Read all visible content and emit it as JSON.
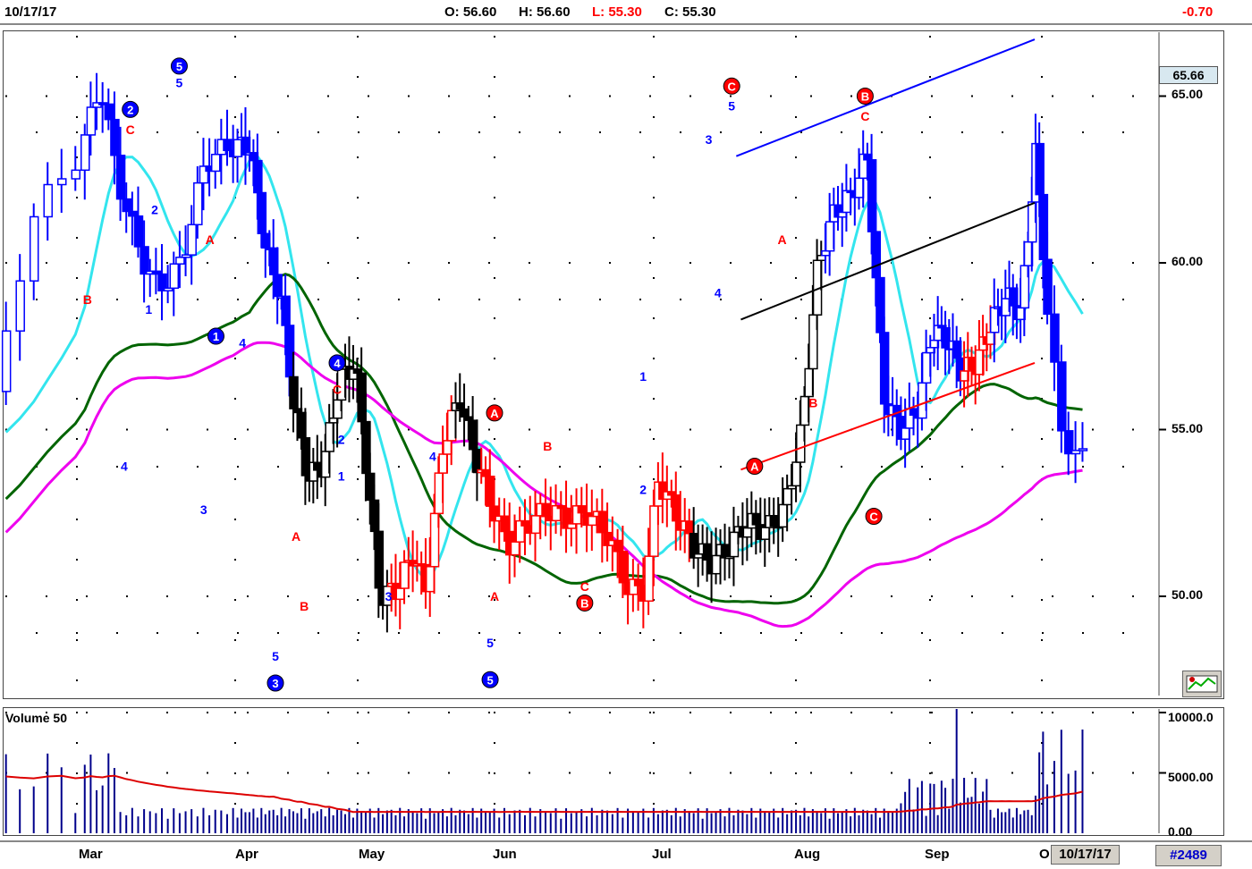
{
  "header": {
    "date": "10/17/17",
    "open_label": "O: 56.60",
    "high_label": "H: 56.60",
    "low_label": "L: 55.30",
    "close_label": "C: 55.30",
    "change": "-0.70"
  },
  "colors": {
    "up_blue": "#0000ff",
    "down_red": "#ff0000",
    "neutral_black": "#000000",
    "ma_cyan": "#33e5ee",
    "ma_green": "#006400",
    "ma_magenta": "#ee00ee",
    "volume_bar": "#00008b",
    "volume_avg": "#dd0000"
  },
  "chart_data": {
    "type": "candlestick",
    "x_axis_months": [
      "Mar",
      "Apr",
      "May",
      "Jun",
      "Jul",
      "Aug",
      "Sep",
      "O"
    ],
    "y_axis_ticks": [
      "65.00",
      "60.00",
      "55.00",
      "50.00"
    ],
    "ylim": [
      46.9,
      66.6
    ],
    "last_price": "65.66",
    "volume_panel": {
      "label": "Volume 50",
      "y_axis_ticks": [
        "10000.0",
        "5000.00",
        "0.00"
      ],
      "ylim": [
        0,
        10300
      ]
    },
    "footer_date": "10/17/17",
    "footer_count": "#2489",
    "wave_labels": [
      {
        "text": "5",
        "circled": true,
        "color": "blue",
        "x": "Feb-22",
        "y": 65.9
      },
      {
        "text": "5",
        "circled": false,
        "color": "blue",
        "x": "Feb-22",
        "y": 65.4
      },
      {
        "text": "4",
        "circled": false,
        "color": "blue",
        "x": "Feb-13",
        "y": 53.9
      },
      {
        "text": "A",
        "circled": false,
        "color": "red",
        "x": "Feb-27",
        "y": 60.7
      },
      {
        "text": "B",
        "circled": false,
        "color": "red",
        "x": "Mar-02",
        "y": 58.9
      },
      {
        "text": "1",
        "circled": true,
        "color": "blue",
        "x": "Feb-28",
        "y": 57.8
      },
      {
        "text": "2",
        "circled": true,
        "color": "blue",
        "x": "Mar-09",
        "y": 64.6
      },
      {
        "text": "C",
        "circled": false,
        "color": "red",
        "x": "Mar-09",
        "y": 64.0
      },
      {
        "text": "2",
        "circled": false,
        "color": "blue",
        "x": "Mar-13",
        "y": 61.6
      },
      {
        "text": "1",
        "circled": false,
        "color": "blue",
        "x": "Mar-12",
        "y": 58.6
      },
      {
        "text": "3",
        "circled": false,
        "color": "blue",
        "x": "Mar-21",
        "y": 52.6
      },
      {
        "text": "4",
        "circled": false,
        "color": "blue",
        "x": "Mar-28",
        "y": 57.6
      },
      {
        "text": "5",
        "circled": false,
        "color": "blue",
        "x": "Apr-05",
        "y": 48.2
      },
      {
        "text": "3",
        "circled": true,
        "color": "blue",
        "x": "Apr-05",
        "y": 47.4
      },
      {
        "text": "A",
        "circled": false,
        "color": "red",
        "x": "Apr-10",
        "y": 51.8
      },
      {
        "text": "B",
        "circled": false,
        "color": "red",
        "x": "Apr-12",
        "y": 49.7
      },
      {
        "text": "4",
        "circled": true,
        "color": "blue",
        "x": "Apr-20",
        "y": 57.0
      },
      {
        "text": "C",
        "circled": false,
        "color": "red",
        "x": "Apr-20",
        "y": 56.2
      },
      {
        "text": "2",
        "circled": false,
        "color": "blue",
        "x": "Apr-21",
        "y": 54.7
      },
      {
        "text": "1",
        "circled": false,
        "color": "blue",
        "x": "Apr-21",
        "y": 53.6
      },
      {
        "text": "3",
        "circled": false,
        "color": "blue",
        "x": "May-02",
        "y": 50.0
      },
      {
        "text": "4",
        "circled": false,
        "color": "blue",
        "x": "May-12",
        "y": 54.2
      },
      {
        "text": "5",
        "circled": false,
        "color": "blue",
        "x": "May-25",
        "y": 48.6
      },
      {
        "text": "5",
        "circled": true,
        "color": "blue",
        "x": "May-25",
        "y": 47.5
      },
      {
        "text": "A",
        "circled": true,
        "color": "red",
        "x": "May-26",
        "y": 55.5
      },
      {
        "text": "A",
        "circled": false,
        "color": "red",
        "x": "May-26",
        "y": 50.0
      },
      {
        "text": "B",
        "circled": false,
        "color": "red",
        "x": "Jun-05",
        "y": 54.5
      },
      {
        "text": "C",
        "circled": false,
        "color": "red",
        "x": "Jun-12",
        "y": 50.3
      },
      {
        "text": "B",
        "circled": true,
        "color": "red",
        "x": "Jun-12",
        "y": 49.8
      },
      {
        "text": "1",
        "circled": false,
        "color": "blue",
        "x": "Jun-23",
        "y": 56.6
      },
      {
        "text": "2",
        "circled": false,
        "color": "blue",
        "x": "Jun-23",
        "y": 53.2
      },
      {
        "text": "3",
        "circled": false,
        "color": "blue",
        "x": "Jul-07",
        "y": 63.7
      },
      {
        "text": "4",
        "circled": false,
        "color": "blue",
        "x": "Jul-09",
        "y": 59.1
      },
      {
        "text": "5",
        "circled": false,
        "color": "blue",
        "x": "Jul-12",
        "y": 64.7
      },
      {
        "text": "C",
        "circled": true,
        "color": "red",
        "x": "Jul-12",
        "y": 65.3
      },
      {
        "text": "A",
        "circled": false,
        "color": "red",
        "x": "Jul-23",
        "y": 60.7
      },
      {
        "text": "A",
        "circled": true,
        "color": "red",
        "x": "Jul-17",
        "y": 53.9
      },
      {
        "text": "B",
        "circled": false,
        "color": "red",
        "x": "Jul-30",
        "y": 55.8
      },
      {
        "text": "B",
        "circled": true,
        "color": "red",
        "x": "Aug-11",
        "y": 65.0
      },
      {
        "text": "C",
        "circled": false,
        "color": "red",
        "x": "Aug-11",
        "y": 64.4
      },
      {
        "text": "C",
        "circled": true,
        "color": "red",
        "x": "Aug-13",
        "y": 52.4
      }
    ],
    "trendlines": [
      {
        "name": "blue channel upper",
        "color": "blue",
        "from": {
          "x": "Jul-13",
          "y": 63.2
        },
        "to": {
          "x": "Sep-22",
          "y": 66.7
        }
      },
      {
        "name": "black channel",
        "color": "black",
        "from": {
          "x": "Jul-14",
          "y": 58.3
        },
        "to": {
          "x": "Sep-22",
          "y": 61.8
        }
      },
      {
        "name": "red support",
        "color": "red",
        "from": {
          "x": "Jul-14",
          "y": 53.8
        },
        "to": {
          "x": "Sep-22",
          "y": 57.0
        }
      }
    ]
  }
}
